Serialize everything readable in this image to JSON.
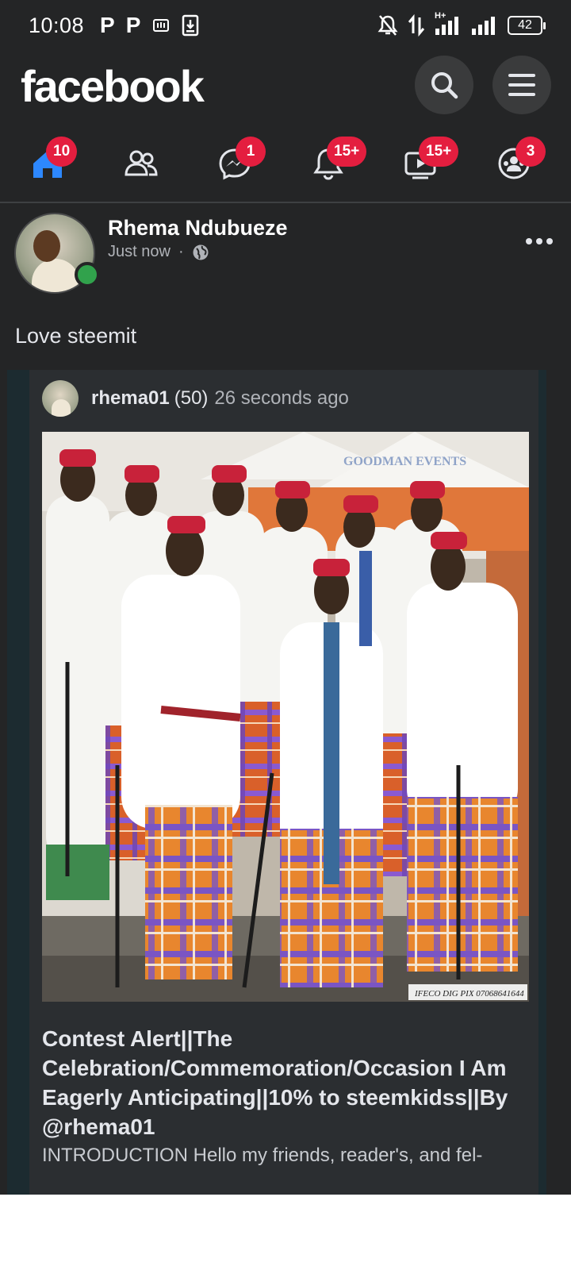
{
  "status_bar": {
    "time": "10:08",
    "left_icons": [
      "P",
      "P",
      "notification-app-icon",
      "download-icon"
    ],
    "network": "H+",
    "battery": "42"
  },
  "header": {
    "logo": "facebook",
    "search_icon": "search-icon",
    "menu_icon": "menu-icon"
  },
  "nav_tabs": [
    {
      "name": "home",
      "icon": "home-icon",
      "badge": "10",
      "active": true
    },
    {
      "name": "friends",
      "icon": "friends-icon",
      "badge": ""
    },
    {
      "name": "messenger",
      "icon": "messenger-icon",
      "badge": "1"
    },
    {
      "name": "notifications",
      "icon": "bell-icon",
      "badge": "15+"
    },
    {
      "name": "watch",
      "icon": "video-icon",
      "badge": "15+"
    },
    {
      "name": "groups",
      "icon": "groups-icon",
      "badge": "3"
    }
  ],
  "colors": {
    "background": "#242526",
    "accent": "#2d88ff",
    "badge": "#e41e3f",
    "online": "#31a24c"
  },
  "post": {
    "author": "Rhema Ndubueze",
    "time": "Just now",
    "separator": "·",
    "privacy_icon": "globe-icon",
    "text": "Love steemit",
    "shared": {
      "username": "rhema01",
      "reputation": "(50)",
      "time": "26 seconds ago",
      "photo_watermark_top": "GOODMAN EVENTS",
      "photo_watermark_bottom": "IFECO DIG PIX 07068641644",
      "title": "Contest Alert||The Celebration/Commemoration/Occasion I Am Eagerly Anticipating||10% to steemkidss||By @rhema01",
      "excerpt": "INTRODUCTION Hello my friends, reader's, and fel-"
    }
  }
}
